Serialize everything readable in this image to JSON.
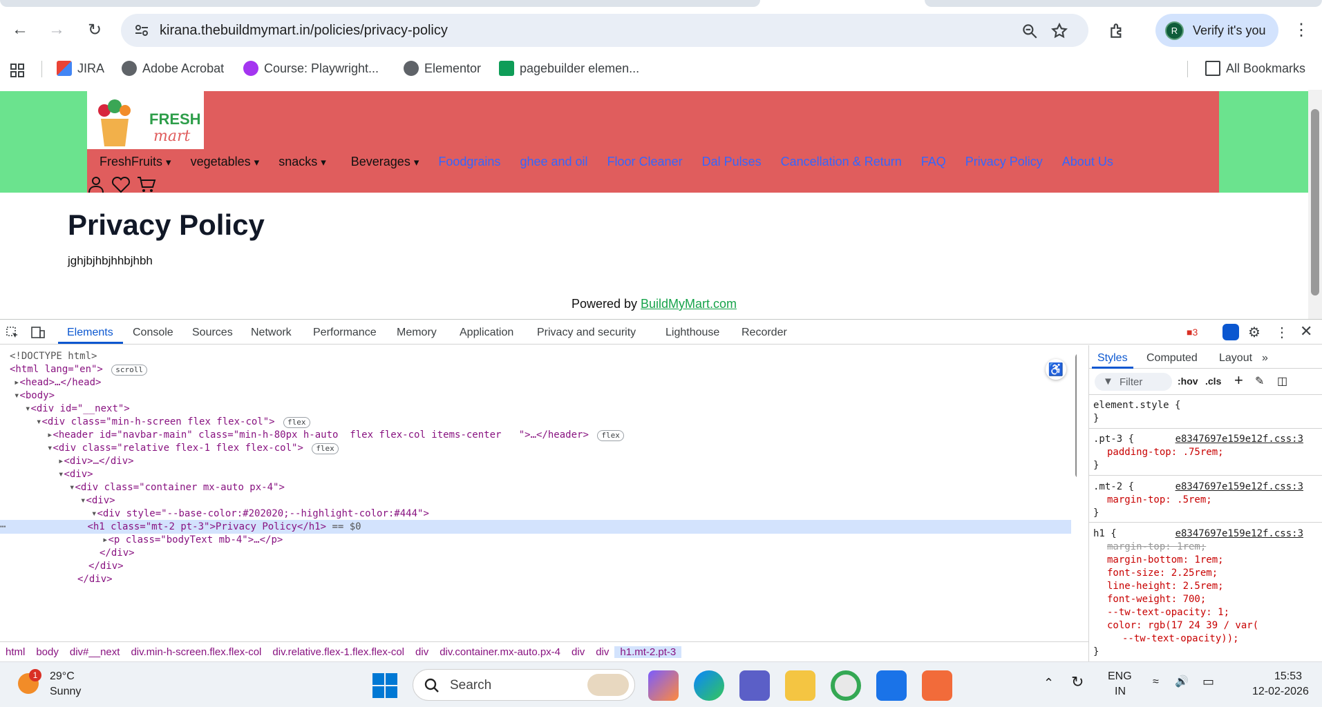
{
  "browser": {
    "url": "kirana.thebuildmymart.in/policies/privacy-policy",
    "profile_initial": "R",
    "verify_label": "Verify it's you",
    "bookmarks": [
      "JIRA",
      "Adobe Acrobat",
      "Course: Playwright...",
      "Elementor",
      "pagebuilder elemen..."
    ],
    "all_bookmarks_label": "All Bookmarks"
  },
  "site": {
    "logo_text": "FRESH mart",
    "nav_dropdowns": [
      "FreshFruits",
      "vegetables",
      "snacks",
      "Beverages"
    ],
    "nav_links": [
      "Foodgrains",
      "ghee and oil",
      "Floor Cleaner",
      "Dal Pulses",
      "Cancellation & Return",
      "FAQ",
      "Privacy Policy",
      "About Us"
    ],
    "page_title": "Privacy Policy",
    "body_text": "jghjbjhbjhhbjhbh",
    "powered_prefix": "Powered by ",
    "powered_link": "BuildMyMart.com",
    "header_color": "#e05d5d",
    "side_color": "#6be38e"
  },
  "devtools": {
    "tabs": [
      "Elements",
      "Console",
      "Sources",
      "Network",
      "Performance",
      "Memory",
      "Application",
      "Privacy and security",
      "Lighthouse",
      "Recorder"
    ],
    "issue_count": "3",
    "dom_lines": [
      "<!DOCTYPE html>",
      "<html lang=\"en\">",
      "<head>…</head>",
      "<body>",
      "<div id=\"__next\">",
      "<div class=\"min-h-screen flex flex-col\">",
      "<header id=\"navbar-main\" class=\"min-h-80px h-auto  flex flex-col items-center   \">…</header>",
      "<div class=\"relative flex-1 flex flex-col\">",
      "<div>…</div>",
      "<div>",
      "<div class=\"container mx-auto px-4\">",
      "<div>",
      "<div style=\"--base-color:#202020;--highlight-color:#444\">",
      "<h1 class=\"mt-2 pt-3\">Privacy Policy</h1>",
      "<p class=\"bodyText mb-4\">…</p>",
      "</div>",
      "</div>",
      "</div>"
    ],
    "badges": {
      "scroll": "scroll",
      "flex": "flex"
    },
    "selected_marker": "== $0",
    "breadcrumb": [
      "html",
      "body",
      "div#__next",
      "div.min-h-screen.flex.flex-col",
      "div.relative.flex-1.flex.flex-col",
      "div",
      "div.container.mx-auto.px-4",
      "div",
      "div",
      "h1.mt-2.pt-3"
    ],
    "styles_tabs": [
      "Styles",
      "Computed",
      "Layout"
    ],
    "filter_placeholder": "Filter",
    "hov": ":hov",
    "cls": ".cls",
    "css_source": "e8347697e159e12f.css:3",
    "rules": {
      "element_style": "element.style {",
      "pt3_sel": ".pt-3 {",
      "pt3_decl": "padding-top: .75rem;",
      "mt2_sel": ".mt-2 {",
      "mt2_decl": "margin-top: .5rem;",
      "h1_sel": "h1 {",
      "h1_decls": [
        "margin-top: 1rem;",
        "margin-bottom: 1rem;",
        "font-size: 2.25rem;",
        "line-height: 2.5rem;",
        "font-weight: 700;",
        "--tw-text-opacity: 1;",
        "color: rgb(17 24 39 / var(",
        "--tw-text-opacity));"
      ],
      "close_brace": "}"
    }
  },
  "taskbar": {
    "weather_temp": "29°C",
    "weather_desc": "Sunny",
    "weather_badge": "1",
    "search_label": "Search",
    "lang_line1": "ENG",
    "lang_line2": "IN",
    "time": "15:53",
    "date": "12-02-2026"
  }
}
